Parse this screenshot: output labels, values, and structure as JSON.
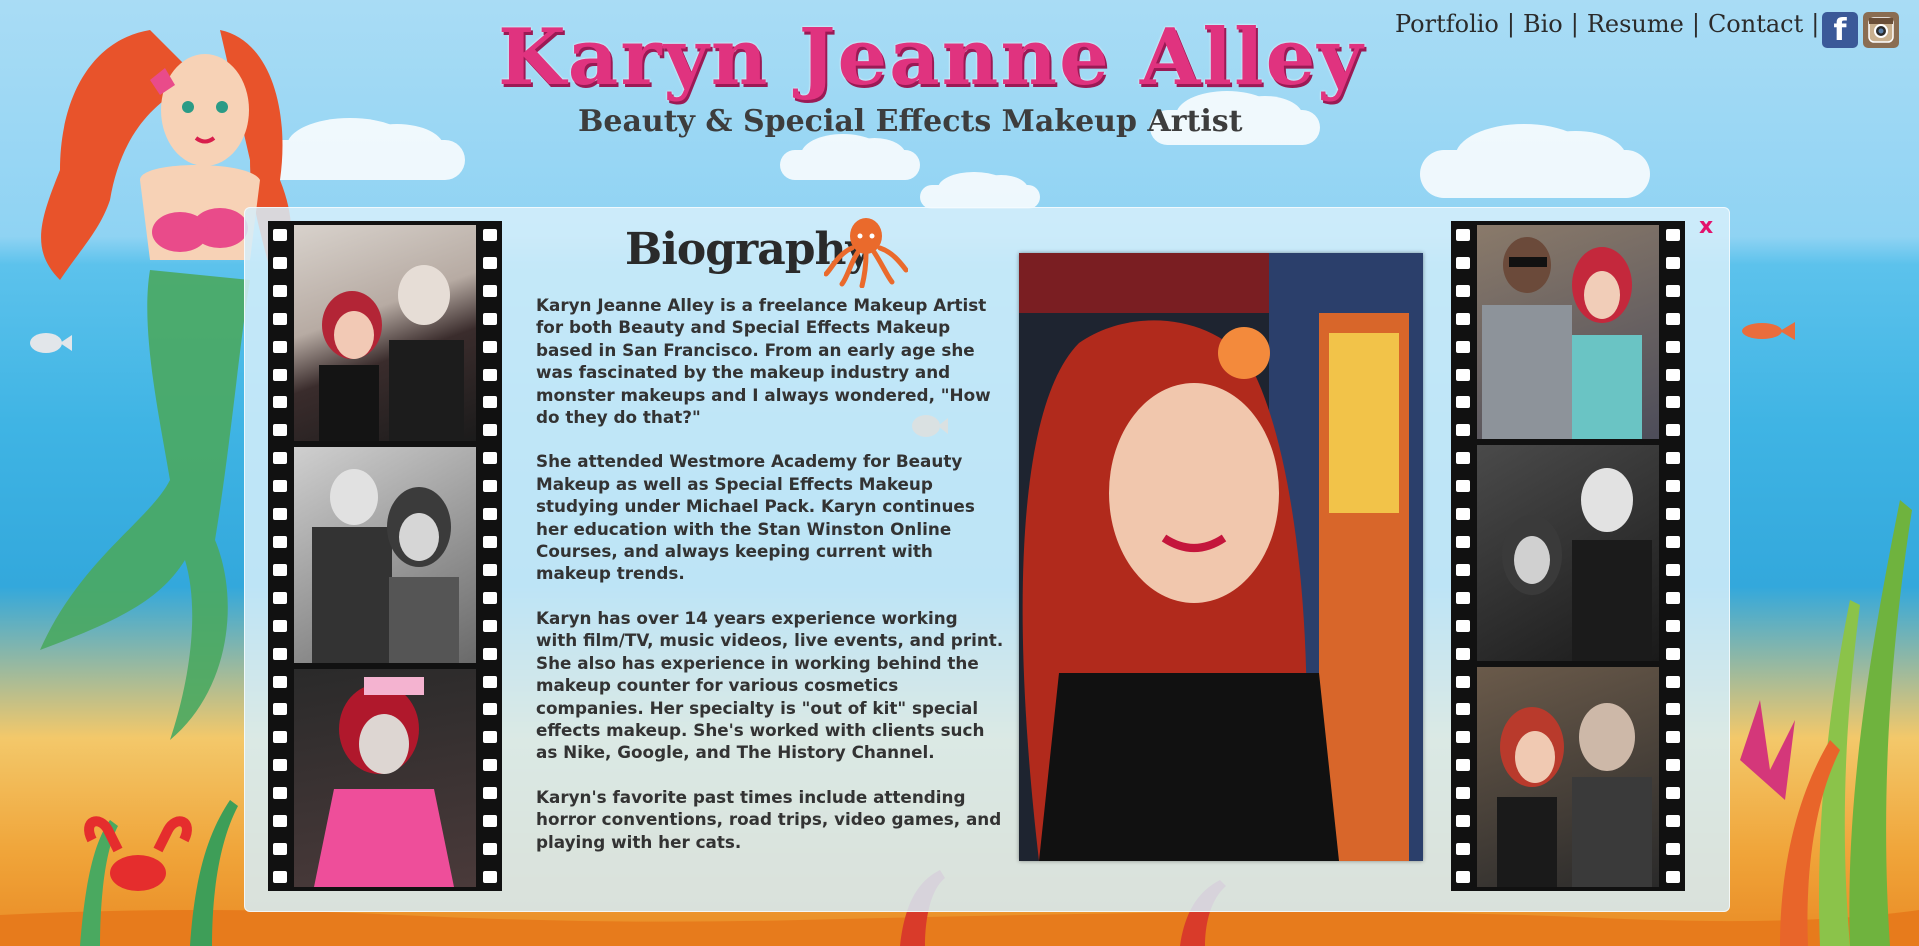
{
  "header": {
    "title": "Karyn Jeanne Alley",
    "subtitle": "Beauty & Special Effects Makeup Artist"
  },
  "nav": {
    "items": [
      "Portfolio",
      "Bio",
      "Resume",
      "Contact"
    ],
    "separator": "|"
  },
  "social": {
    "facebook_icon": "facebook-icon",
    "facebook_glyph": "f",
    "instagram_icon": "instagram-icon"
  },
  "panel": {
    "close_label": "x",
    "heading": "Biography",
    "paragraphs": [
      "Karyn Jeanne Alley is a freelance Makeup Artist for both Beauty and Special Effects Makeup based in San Francisco.  From an early age she was fascinated by the makeup industry and monster makeups and I always wondered, \"How do they do that?\"",
      "She attended Westmore Academy for Beauty Makeup as well as Special Effects Makeup studying under Michael Pack.  Karyn continues her education with the Stan Winston Online Courses, and always keeping current with makeup trends.",
      "Karyn has over 14 years experience working with film/TV, music videos, live events, and print. She also has experience in working behind the makeup counter for various cosmetics companies. Her specialty is \"out of kit\" special effects makeup.  She's worked with clients such as Nike, Google, and The History Channel.",
      "Karyn's favorite past times include attending horror conventions, road trips, video games, and playing with her cats."
    ]
  },
  "colors": {
    "title_pink": "#e0337f",
    "close_pink": "#e2126c",
    "sky": "#8fd3f3",
    "sand": "#f0a53a"
  }
}
